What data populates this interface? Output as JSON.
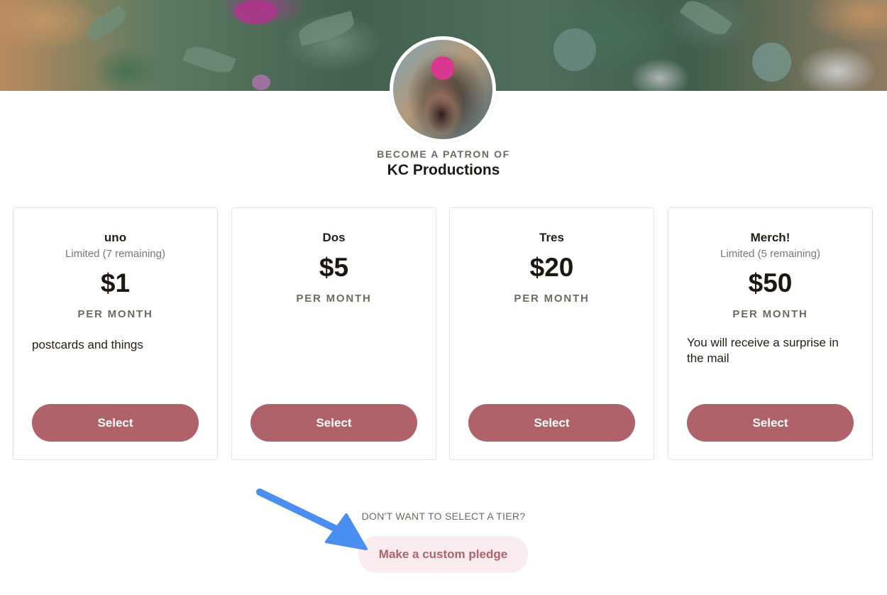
{
  "header": {
    "eyebrow": "BECOME A PATRON OF",
    "creator_name": "KC Productions"
  },
  "tiers": [
    {
      "name": "uno",
      "limit": "Limited (7 remaining)",
      "price": "$1",
      "period": "PER MONTH",
      "description": "postcards and things",
      "button": "Select"
    },
    {
      "name": "Dos",
      "limit": "",
      "price": "$5",
      "period": "PER MONTH",
      "description": "",
      "button": "Select"
    },
    {
      "name": "Tres",
      "limit": "",
      "price": "$20",
      "period": "PER MONTH",
      "description": "",
      "button": "Select"
    },
    {
      "name": "Merch!",
      "limit": "Limited (5 remaining)",
      "price": "$50",
      "period": "PER MONTH",
      "description": "You will receive a surprise in the mail",
      "button": "Select"
    }
  ],
  "custom_pledge": {
    "prompt": "DON'T WANT TO SELECT A TIER?",
    "button": "Make a custom pledge"
  },
  "colors": {
    "accent": "#b0626b",
    "accent_light": "#f9ebee",
    "annotation_arrow": "#4a8ff0"
  }
}
